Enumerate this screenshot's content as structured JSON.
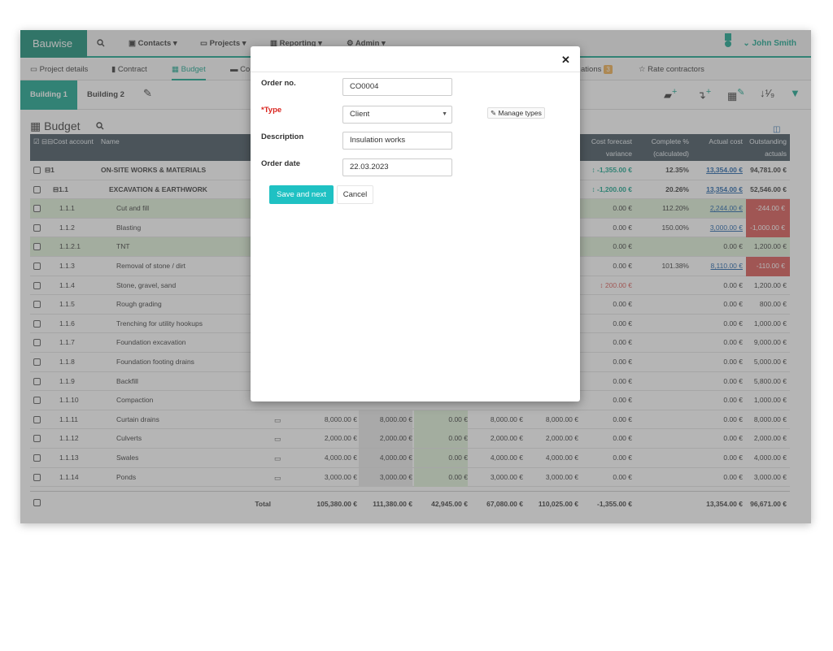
{
  "nav": {
    "brand": "Bauwise",
    "search_icon": "search-icon",
    "contacts": "Contacts ▾",
    "projects": "Projects ▾",
    "reporting": "Reporting ▾",
    "admin": "Admin ▾",
    "user": "John Smith"
  },
  "tabs": {
    "project_details": "Project details",
    "contract": "Contract",
    "budget": "Budget",
    "partial": "Co",
    "ations": "ations",
    "ations_badge": "3",
    "rate_contractors": "Rate contractors"
  },
  "buildings": {
    "b1": "Building 1",
    "b2": "Building 2"
  },
  "grid": {
    "title": "Budget",
    "headers": {
      "cost_account": "Cost account",
      "name": "Name",
      "cost_forecast_variance": "Cost forecast variance",
      "complete_pct": "Complete % (calculated)",
      "actual_cost": "Actual cost",
      "outstanding": "Outstanding actuals"
    },
    "rows": [
      {
        "code": "1",
        "name": "ON-SITE WORKS & MATERIALS",
        "variance": "-1,355.00 €",
        "pct": "12.35%",
        "actual": "13,354.00 €",
        "out": "94,781.00 €"
      },
      {
        "code": "1.1",
        "name": "EXCAVATION & EARTHWORK",
        "variance": "-1,200.00 €",
        "pct": "20.26%",
        "actual": "13,354.00 €",
        "out": "52,546.00 €"
      },
      {
        "code": "1.1.1",
        "name": "Cut and fill",
        "variance": "0.00 €",
        "pct": "112.20%",
        "actual": "2,244.00 €",
        "out": "-244.00 €"
      },
      {
        "code": "1.1.2",
        "name": "Blasting",
        "variance": "0.00 €",
        "pct": "150.00%",
        "actual": "3,000.00 €",
        "out": "-1,000.00 €"
      },
      {
        "code": "1.1.2.1",
        "name": "TNT",
        "variance": "0.00 €",
        "pct": "",
        "actual": "0.00 €",
        "out": "1,200.00 €"
      },
      {
        "code": "1.1.3",
        "name": "Removal of stone / dirt",
        "variance": "0.00 €",
        "pct": "101.38%",
        "actual": "8,110.00 €",
        "out": "-110.00 €"
      },
      {
        "code": "1.1.4",
        "name": "Stone, gravel, sand",
        "variance": "200.00 €",
        "pct": "",
        "actual": "0.00 €",
        "out": "1,200.00 €"
      },
      {
        "code": "1.1.5",
        "name": "Rough grading",
        "variance": "0.00 €",
        "pct": "",
        "actual": "0.00 €",
        "out": "800.00 €"
      },
      {
        "code": "1.1.6",
        "name": "Trenching for utility hookups",
        "variance": "0.00 €",
        "pct": "",
        "actual": "0.00 €",
        "out": "1,000.00 €"
      },
      {
        "code": "1.1.7",
        "name": "Foundation excavation",
        "variance": "0.00 €",
        "pct": "",
        "actual": "0.00 €",
        "out": "9,000.00 €"
      },
      {
        "code": "1.1.8",
        "name": "Foundation footing drains",
        "variance": "0.00 €",
        "pct": "",
        "actual": "0.00 €",
        "out": "5,000.00 €"
      },
      {
        "code": "1.1.9",
        "name": "Backfill",
        "variance": "0.00 €",
        "pct": "",
        "actual": "0.00 €",
        "out": "5,800.00 €"
      },
      {
        "code": "1.1.10",
        "name": "Compaction",
        "variance": "0.00 €",
        "pct": "",
        "actual": "0.00 €",
        "out": "1,000.00 €"
      },
      {
        "code": "1.1.11",
        "name": "Curtain drains",
        "c1": "8,000.00 €",
        "c2": "8,000.00 €",
        "c3": "0.00 €",
        "c4": "8,000.00 €",
        "c5": "8,000.00 €",
        "variance": "0.00 €",
        "pct": "",
        "actual": "0.00 €",
        "out": "8,000.00 €"
      },
      {
        "code": "1.1.12",
        "name": "Culverts",
        "c1": "2,000.00 €",
        "c2": "2,000.00 €",
        "c3": "0.00 €",
        "c4": "2,000.00 €",
        "c5": "2,000.00 €",
        "variance": "0.00 €",
        "pct": "",
        "actual": "0.00 €",
        "out": "2,000.00 €"
      },
      {
        "code": "1.1.13",
        "name": "Swales",
        "c1": "4,000.00 €",
        "c2": "4,000.00 €",
        "c3": "0.00 €",
        "c4": "4,000.00 €",
        "c5": "4,000.00 €",
        "variance": "0.00 €",
        "pct": "",
        "actual": "0.00 €",
        "out": "4,000.00 €"
      },
      {
        "code": "1.1.14",
        "name": "Ponds",
        "c1": "3,000.00 €",
        "c2": "3,000.00 €",
        "c3": "0.00 €",
        "c4": "3,000.00 €",
        "c5": "3,000.00 €",
        "variance": "0.00 €",
        "pct": "",
        "actual": "0.00 €",
        "out": "3,000.00 €"
      }
    ],
    "total": {
      "label": "Total",
      "c1": "105,380.00 €",
      "c2": "111,380.00 €",
      "c3": "42,945.00 €",
      "c4": "67,080.00 €",
      "c5": "110,025.00 €",
      "variance": "-1,355.00 €",
      "actual": "13,354.00 €",
      "out": "96,671.00 €"
    }
  },
  "modal": {
    "order_no_label": "Order no.",
    "order_no_value": "CO0004",
    "type_label": "*Type",
    "type_value": "Client",
    "manage_types": "Manage types",
    "description_label": "Description",
    "description_value": "Insulation works",
    "order_date_label": "Order date",
    "order_date_value": "22.03.2023",
    "save_label": "Save and next",
    "cancel_label": "Cancel"
  }
}
